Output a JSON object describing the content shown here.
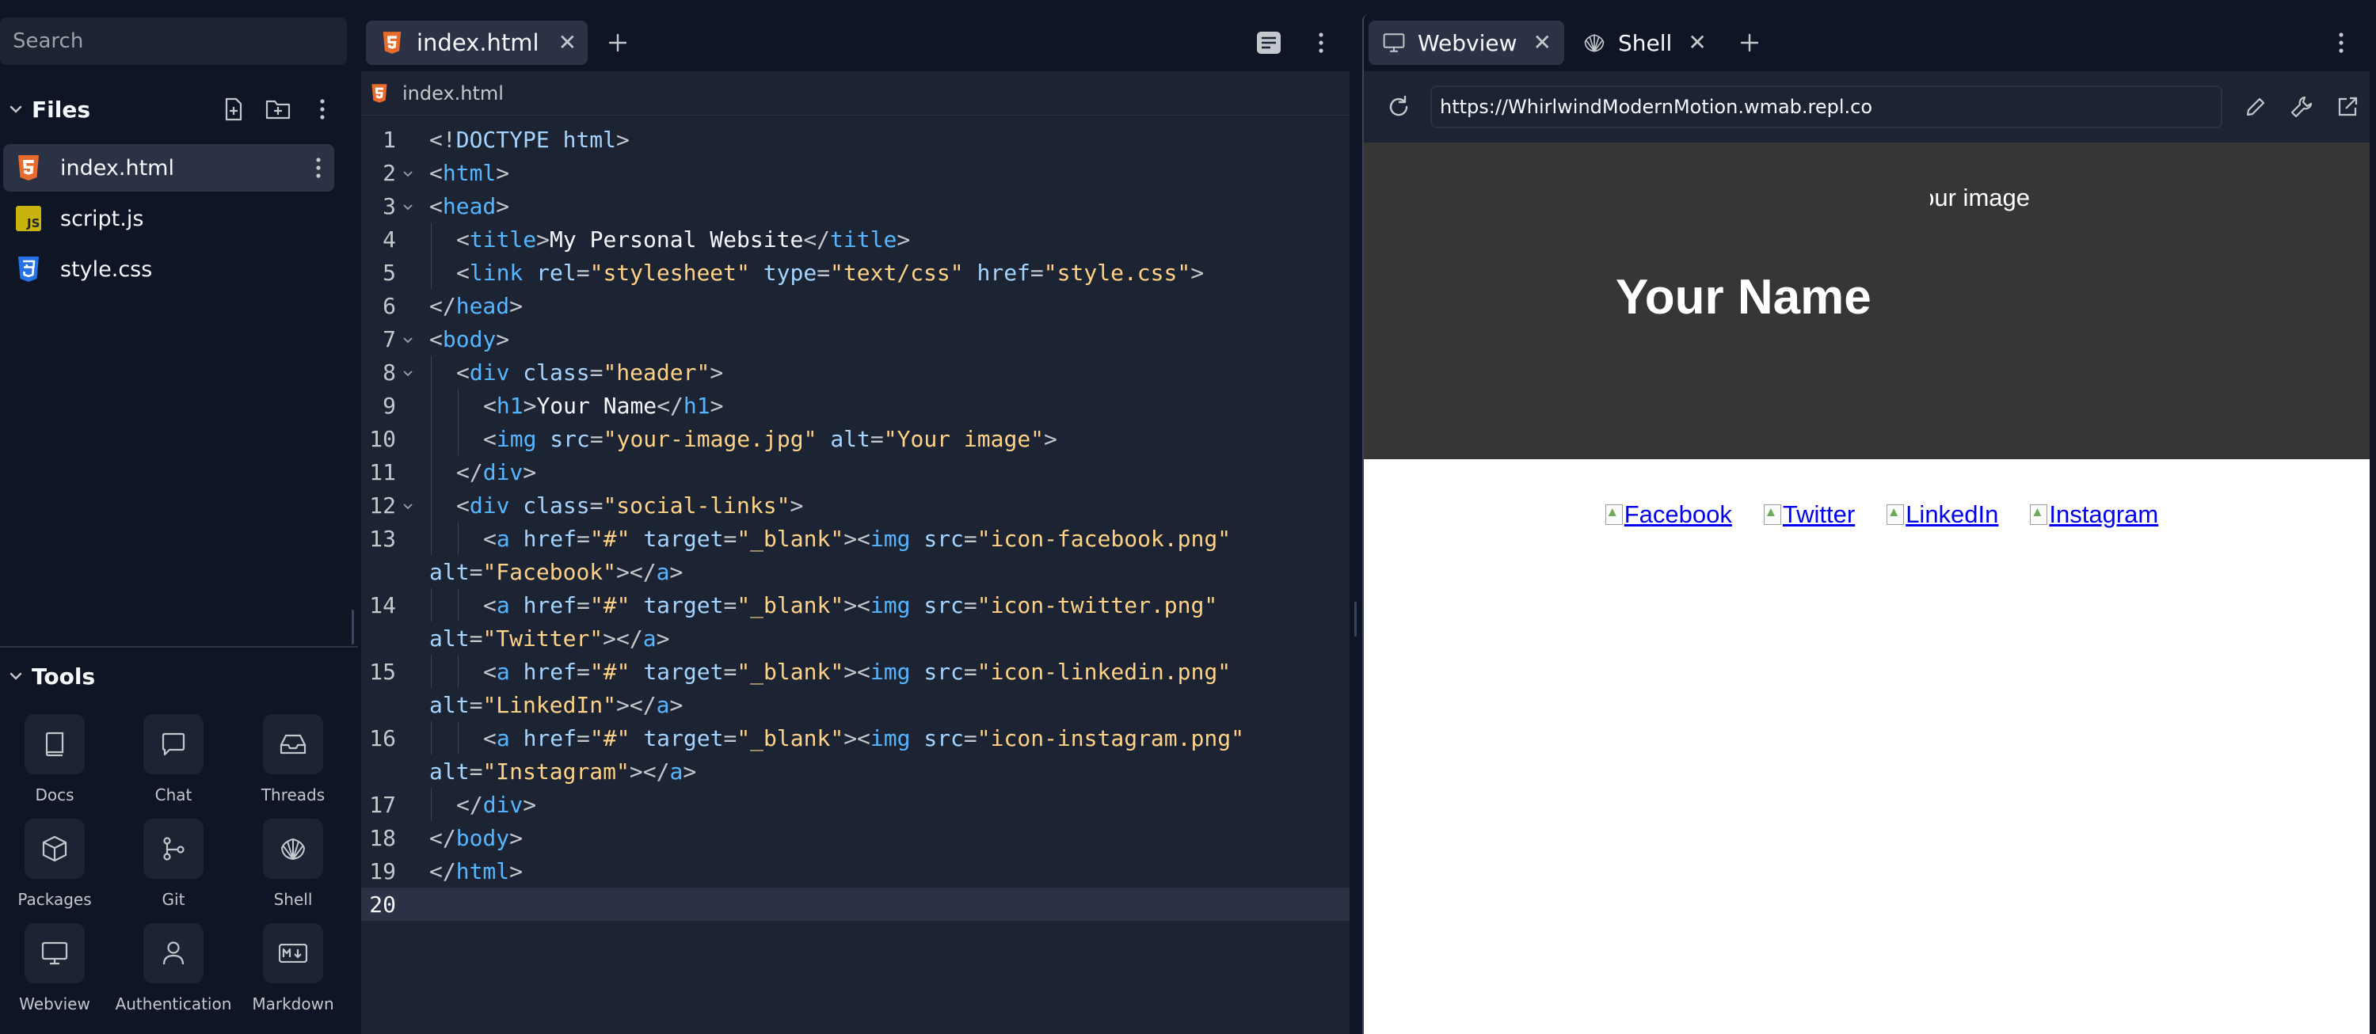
{
  "sidebar": {
    "search_placeholder": "Search",
    "files_title": "Files",
    "files": [
      {
        "name": "index.html",
        "icon": "html5-icon",
        "color": "#e76b2c"
      },
      {
        "name": "script.js",
        "icon": "javascript-icon",
        "color": "#c9b40f"
      },
      {
        "name": "style.css",
        "icon": "css3-icon",
        "color": "#2673e8"
      }
    ],
    "tools_title": "Tools",
    "tools": [
      {
        "label": "Docs",
        "icon": "book-icon"
      },
      {
        "label": "Chat",
        "icon": "chat-icon"
      },
      {
        "label": "Threads",
        "icon": "inbox-icon"
      },
      {
        "label": "Packages",
        "icon": "package-icon"
      },
      {
        "label": "Git",
        "icon": "git-icon"
      },
      {
        "label": "Shell",
        "icon": "shell-icon"
      },
      {
        "label": "Webview",
        "icon": "monitor-icon"
      },
      {
        "label": "Authentication",
        "icon": "user-icon"
      },
      {
        "label": "Markdown",
        "icon": "markdown-icon"
      }
    ]
  },
  "editor": {
    "tab_label": "index.html",
    "breadcrumb": "index.html",
    "current_line": 20,
    "lines": [
      {
        "n": "1",
        "fold": false,
        "indent": 0,
        "text": "<!DOCTYPE html>"
      },
      {
        "n": "2",
        "fold": true,
        "indent": 0,
        "text": "<html>"
      },
      {
        "n": "3",
        "fold": true,
        "indent": 0,
        "text": "<head>"
      },
      {
        "n": "4",
        "fold": false,
        "indent": 1,
        "text": "<title>My Personal Website</title>"
      },
      {
        "n": "5",
        "fold": false,
        "indent": 1,
        "text": "<link rel=\"stylesheet\" type=\"text/css\" href=\"style.css\">"
      },
      {
        "n": "6",
        "fold": false,
        "indent": 0,
        "text": "</head>"
      },
      {
        "n": "7",
        "fold": true,
        "indent": 0,
        "text": "<body>"
      },
      {
        "n": "8",
        "fold": true,
        "indent": 1,
        "text": "<div class=\"header\">"
      },
      {
        "n": "9",
        "fold": false,
        "indent": 2,
        "text": "<h1>Your Name</h1>"
      },
      {
        "n": "10",
        "fold": false,
        "indent": 2,
        "text": "<img src=\"your-image.jpg\" alt=\"Your image\">"
      },
      {
        "n": "11",
        "fold": false,
        "indent": 1,
        "text": "</div>"
      },
      {
        "n": "12",
        "fold": true,
        "indent": 1,
        "text": "<div class=\"social-links\">"
      },
      {
        "n": "13",
        "fold": false,
        "indent": 2,
        "text": "<a href=\"#\" target=\"_blank\"><img src=\"icon-facebook.png\""
      },
      {
        "n": "",
        "fold": false,
        "indent": 0,
        "text": "alt=\"Facebook\"></a>"
      },
      {
        "n": "14",
        "fold": false,
        "indent": 2,
        "text": "<a href=\"#\" target=\"_blank\"><img src=\"icon-twitter.png\""
      },
      {
        "n": "",
        "fold": false,
        "indent": 0,
        "text": "alt=\"Twitter\"></a>"
      },
      {
        "n": "15",
        "fold": false,
        "indent": 2,
        "text": "<a href=\"#\" target=\"_blank\"><img src=\"icon-linkedin.png\""
      },
      {
        "n": "",
        "fold": false,
        "indent": 0,
        "text": "alt=\"LinkedIn\"></a>"
      },
      {
        "n": "16",
        "fold": false,
        "indent": 2,
        "text": "<a href=\"#\" target=\"_blank\"><img src=\"icon-instagram.png\""
      },
      {
        "n": "",
        "fold": false,
        "indent": 0,
        "text": "alt=\"Instagram\"></a>"
      },
      {
        "n": "17",
        "fold": false,
        "indent": 1,
        "text": "</div>"
      },
      {
        "n": "18",
        "fold": false,
        "indent": 0,
        "text": "</body>"
      },
      {
        "n": "19",
        "fold": false,
        "indent": 0,
        "text": "</html>"
      },
      {
        "n": "20",
        "fold": false,
        "indent": 0,
        "text": ""
      }
    ]
  },
  "preview": {
    "tabs": [
      {
        "label": "Webview",
        "icon": "monitor-icon"
      },
      {
        "label": "Shell",
        "icon": "shell-icon"
      }
    ],
    "url": "https://WhirlwindModernMotion.wmab.repl.co",
    "site": {
      "image_alt": "Your image",
      "name": "Your Name",
      "links": [
        "Facebook",
        "Twitter",
        "LinkedIn",
        "Instagram"
      ]
    }
  }
}
